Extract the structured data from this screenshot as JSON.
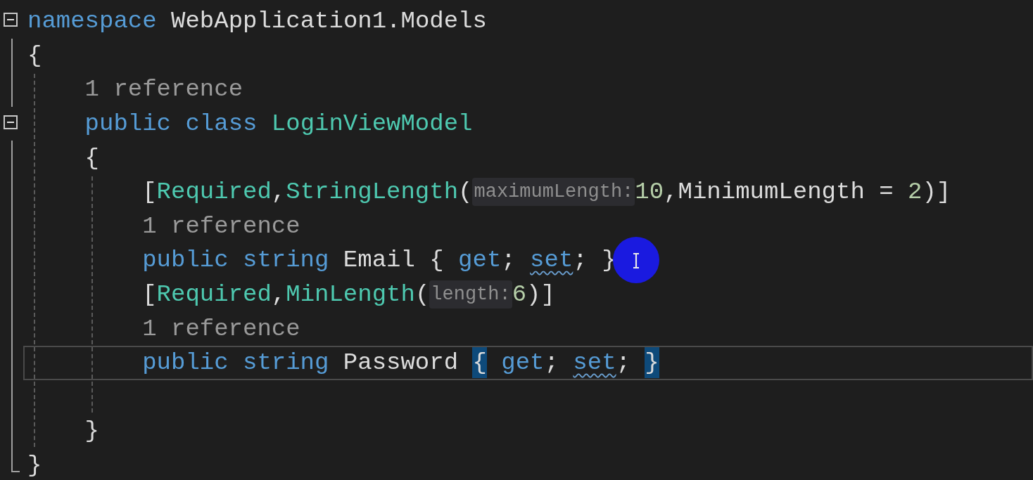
{
  "code": [
    {
      "kind": "block",
      "expanded": true,
      "header": [
        {
          "kind": "keyword",
          "text": "namespace"
        },
        {
          "kind": "plain",
          "text": " WebApplication1.Models"
        }
      ],
      "open": "{",
      "close": "}",
      "body": [
        {
          "kind": "codelens",
          "text": "1 reference"
        },
        {
          "kind": "block",
          "expanded": true,
          "header": [
            {
              "kind": "keyword",
              "text": "public class"
            },
            {
              "kind": "type",
              "text": " LoginViewModel"
            }
          ],
          "open": "{",
          "close": "}",
          "body": [
            {
              "kind": "line",
              "current": false,
              "tokens": [
                {
                  "kind": "plain",
                  "text": "["
                },
                {
                  "kind": "type",
                  "text": "Required"
                },
                {
                  "kind": "plain",
                  "text": ","
                },
                {
                  "kind": "type",
                  "text": "StringLength"
                },
                {
                  "kind": "plain",
                  "text": "("
                },
                {
                  "kind": "hint",
                  "text": "maximumLength:"
                },
                {
                  "kind": "number",
                  "text": "10"
                },
                {
                  "kind": "plain",
                  "text": ",MinimumLength = "
                },
                {
                  "kind": "number",
                  "text": "2"
                },
                {
                  "kind": "plain",
                  "text": ")]"
                }
              ]
            },
            {
              "kind": "codelens",
              "text": "1 reference"
            },
            {
              "kind": "line",
              "current": false,
              "tokens": [
                {
                  "kind": "keyword",
                  "text": "public string"
                },
                {
                  "kind": "plain",
                  "text": " Email { "
                },
                {
                  "kind": "keyword",
                  "text": "get"
                },
                {
                  "kind": "plain",
                  "text": "; "
                },
                {
                  "kind": "keyword",
                  "text": "set",
                  "squiggle": true
                },
                {
                  "kind": "plain",
                  "text": "; }"
                }
              ]
            },
            {
              "kind": "line",
              "current": false,
              "tokens": [
                {
                  "kind": "plain",
                  "text": "["
                },
                {
                  "kind": "type",
                  "text": "Required"
                },
                {
                  "kind": "plain",
                  "text": ","
                },
                {
                  "kind": "type",
                  "text": "MinLength"
                },
                {
                  "kind": "plain",
                  "text": "("
                },
                {
                  "kind": "hint",
                  "text": "length:"
                },
                {
                  "kind": "number",
                  "text": "6"
                },
                {
                  "kind": "plain",
                  "text": ")]"
                }
              ]
            },
            {
              "kind": "codelens",
              "text": "1 reference"
            },
            {
              "kind": "line",
              "current": true,
              "tokens": [
                {
                  "kind": "keyword",
                  "text": "public string"
                },
                {
                  "kind": "plain",
                  "text": " Password "
                },
                {
                  "kind": "plain",
                  "text": "{",
                  "matched": true
                },
                {
                  "kind": "keyword",
                  "text": " get"
                },
                {
                  "kind": "plain",
                  "text": "; "
                },
                {
                  "kind": "keyword",
                  "text": "set",
                  "squiggle": true
                },
                {
                  "kind": "plain",
                  "text": "; "
                },
                {
                  "kind": "plain",
                  "text": "}",
                  "matched": true
                }
              ]
            },
            {
              "kind": "blank"
            }
          ]
        }
      ]
    }
  ]
}
